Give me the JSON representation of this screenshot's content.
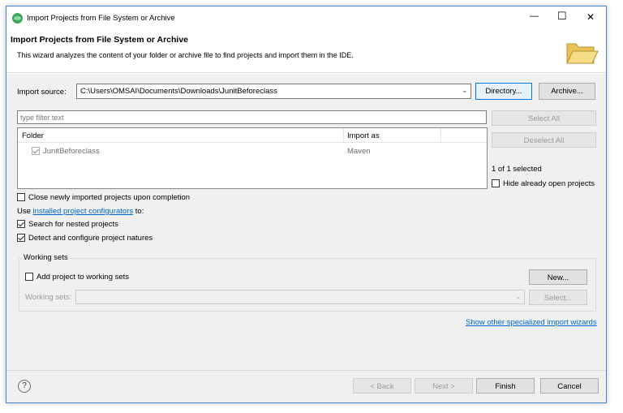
{
  "window": {
    "title": "Import Projects from File System or Archive",
    "minimize_glyph": "—",
    "maximize_glyph": "☐",
    "close_glyph": "✕"
  },
  "header": {
    "title": "Import Projects from File System or Archive",
    "description": "This wizard analyzes the content of your folder or archive file to find projects and import them in the IDE."
  },
  "import_source": {
    "label": "Import source:",
    "value": "C:\\Users\\OMSAI\\Documents\\Downloads\\JunitBeforeclass",
    "directory_button": "Directory...",
    "archive_button": "Archive..."
  },
  "filter": {
    "placeholder": "type filter text"
  },
  "table": {
    "columns": [
      "Folder",
      "Import as"
    ],
    "rows": [
      {
        "folder": "JunitBeforeclass",
        "import_as": "Maven",
        "checked": true
      }
    ]
  },
  "side_buttons": {
    "select_all": "Select All",
    "deselect_all": "Deselect All",
    "selected_count": "1 of 1 selected",
    "hide_open_label": "Hide already open projects"
  },
  "options": {
    "close_after": "Close newly imported projects upon completion",
    "use_prefix": "Use",
    "configurators_link": "installed project configurators",
    "use_suffix": "to:",
    "search_nested": "Search for nested projects",
    "detect_natures": "Detect and configure project natures"
  },
  "working_sets": {
    "group_label": "Working sets",
    "add_label": "Add project to working sets",
    "new_button": "New...",
    "sets_label": "Working sets:",
    "select_button": "Select..."
  },
  "footer": {
    "other_wizards_link": "Show other specialized import wizards",
    "help_glyph": "?",
    "back_button": "< Back",
    "next_button": "Next >",
    "finish_button": "Finish",
    "cancel_button": "Cancel"
  },
  "colors": {
    "accent": "#0078d7",
    "link": "#0066cc",
    "header_bg": "#ffffff",
    "dialog_bg": "#f0f0f0"
  }
}
